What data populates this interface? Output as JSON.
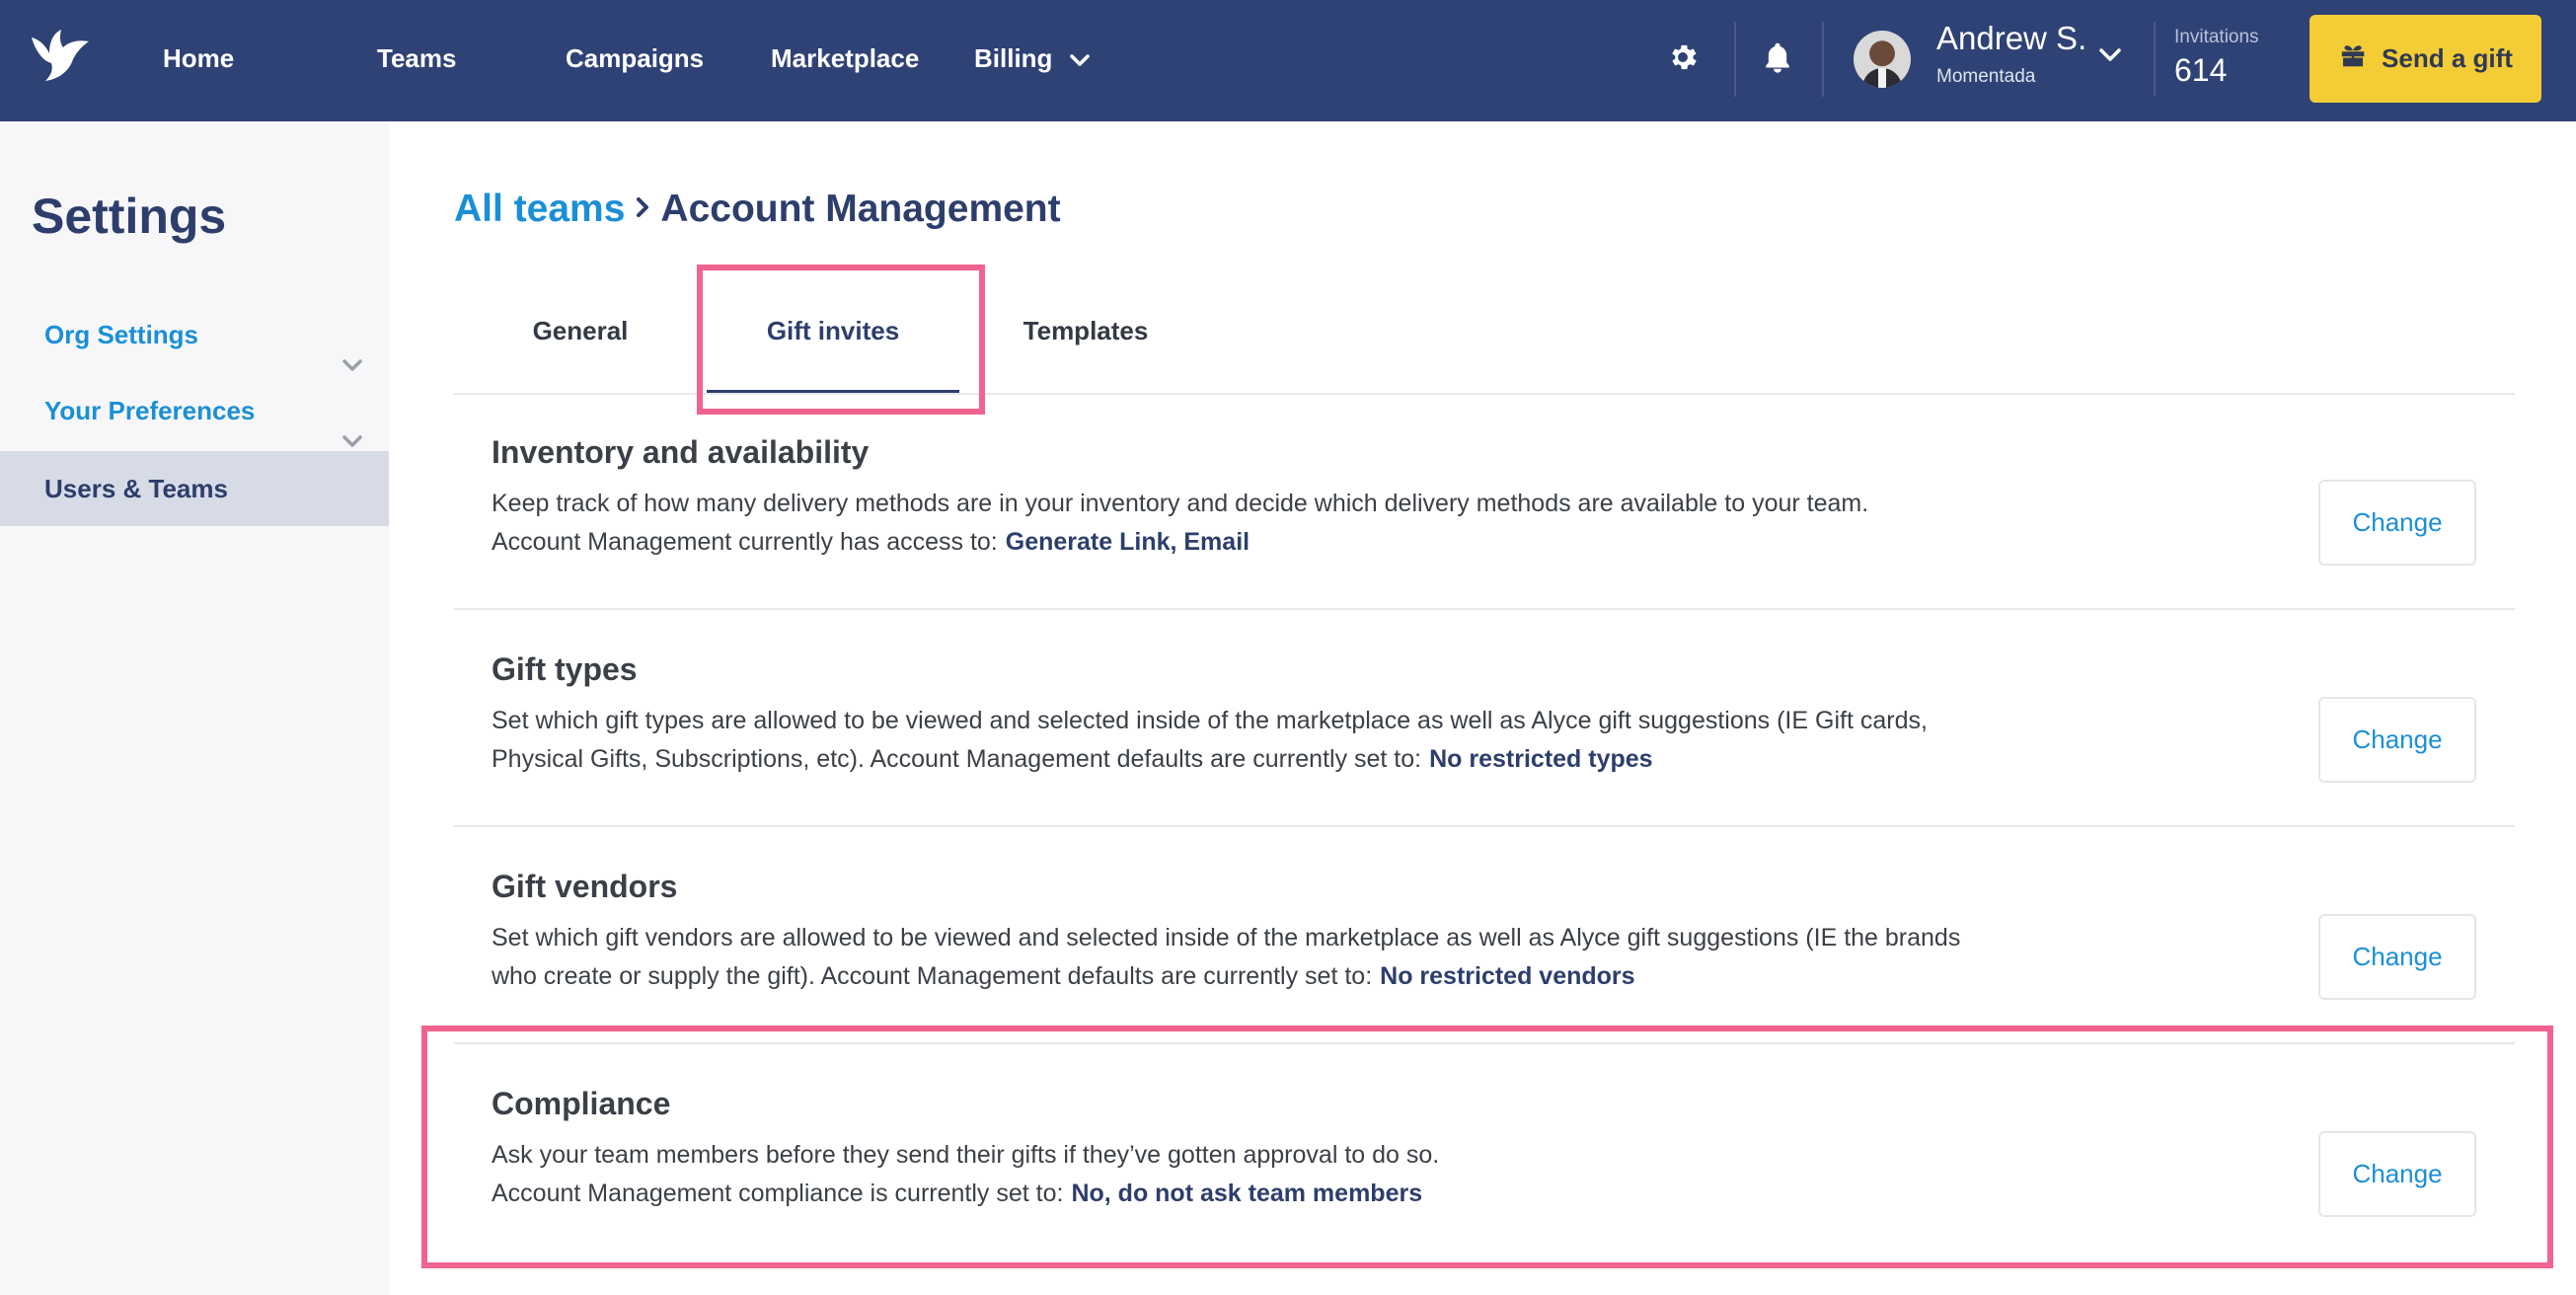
{
  "colors": {
    "nav_bg": "#2f4275",
    "accent_blue": "#1b8fd6",
    "dark_navy": "#2d3e6c",
    "gift_button": "#f4cc36",
    "highlight": "#f0638f"
  },
  "nav": {
    "items": [
      {
        "label": "Home"
      },
      {
        "label": "Teams"
      },
      {
        "label": "Campaigns"
      },
      {
        "label": "Marketplace"
      },
      {
        "label": "Billing"
      }
    ],
    "icons": [
      "bird-logo-icon",
      "gear-icon",
      "bell-icon",
      "chevron-down-icon",
      "gift-icon"
    ]
  },
  "user": {
    "name": "Andrew S.",
    "org": "Momentada"
  },
  "invitations": {
    "label": "Invitations",
    "count": "614"
  },
  "send_gift": {
    "label": "Send a gift"
  },
  "sidebar": {
    "title": "Settings",
    "items": [
      {
        "label": "Org Settings"
      },
      {
        "label": "Your Preferences"
      },
      {
        "label": "Users & Teams"
      }
    ]
  },
  "breadcrumb": {
    "parent": "All teams",
    "current": "Account Management"
  },
  "tabs": [
    {
      "label": "General"
    },
    {
      "label": "Gift invites"
    },
    {
      "label": "Templates"
    }
  ],
  "sections": [
    {
      "title": "Inventory and availability",
      "line1": "Keep track of how many delivery methods are in your inventory and decide which delivery methods are available to your team.",
      "line2": "Account Management currently has access to:",
      "value": "Generate Link, Email",
      "button": "Change"
    },
    {
      "title": "Gift types",
      "line1": "Set which gift types are allowed to be viewed and selected inside of the marketplace as well as Alyce gift suggestions (IE Gift cards, Physical Gifts, Subscriptions, etc). Account Management defaults are currently set to:",
      "value": "No restricted types",
      "button": "Change"
    },
    {
      "title": "Gift vendors",
      "line1": "Set which gift vendors are allowed to be viewed and selected inside of the marketplace as well as Alyce gift suggestions (IE the brands who create or supply the gift). Account Management defaults are currently set to:",
      "value": "No restricted vendors",
      "button": "Change"
    },
    {
      "title": "Compliance",
      "line1": "Ask your team members before they send their gifts if they’ve gotten approval to do so.",
      "line2": "Account Management compliance is currently set to:",
      "value": "No, do not ask team members",
      "button": "Change"
    }
  ]
}
